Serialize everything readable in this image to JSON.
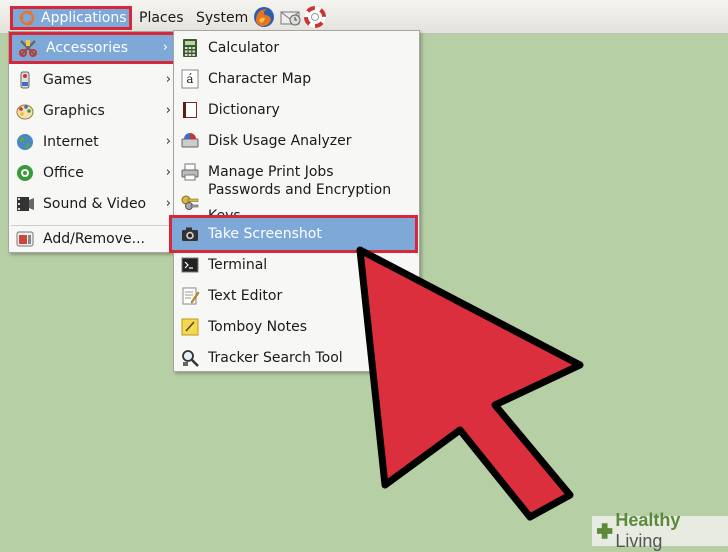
{
  "panel": {
    "applications_label": "Applications",
    "places_label": "Places",
    "system_label": "System",
    "launchers": [
      "firefox-icon",
      "mail-icon",
      "help-icon"
    ]
  },
  "applications_menu": {
    "items": [
      {
        "label": "Accessories",
        "icon": "accessories-icon",
        "has_submenu": true,
        "highlighted": true
      },
      {
        "label": "Games",
        "icon": "games-icon",
        "has_submenu": true
      },
      {
        "label": "Graphics",
        "icon": "graphics-icon",
        "has_submenu": true
      },
      {
        "label": "Internet",
        "icon": "internet-icon",
        "has_submenu": true
      },
      {
        "label": "Office",
        "icon": "office-icon",
        "has_submenu": true
      },
      {
        "label": "Sound & Video",
        "icon": "sound-video-icon",
        "has_submenu": true
      }
    ],
    "footer_item": {
      "label": "Add/Remove...",
      "icon": "add-remove-icon"
    }
  },
  "accessories_menu": {
    "items": [
      {
        "label": "Calculator",
        "icon": "calculator-icon"
      },
      {
        "label": "Character Map",
        "icon": "character-map-icon"
      },
      {
        "label": "Dictionary",
        "icon": "dictionary-icon"
      },
      {
        "label": "Disk Usage Analyzer",
        "icon": "disk-usage-icon"
      },
      {
        "label": "Manage Print Jobs",
        "icon": "printer-icon"
      },
      {
        "label": "Passwords and Encryption Keys",
        "icon": "keys-icon"
      },
      {
        "label": "Take Screenshot",
        "icon": "camera-icon",
        "highlighted": true
      },
      {
        "label": "Terminal",
        "icon": "terminal-icon"
      },
      {
        "label": "Text Editor",
        "icon": "text-editor-icon"
      },
      {
        "label": "Tomboy Notes",
        "icon": "notes-icon"
      },
      {
        "label": "Tracker Search Tool",
        "icon": "search-tool-icon"
      }
    ],
    "char_map_glyph": "á"
  },
  "submenu_arrow": "›",
  "watermark": {
    "brand_bold": "Healthy",
    "brand_rest": " Living"
  },
  "colors": {
    "highlight": "#7da8d8",
    "callout_red": "#d6283a",
    "desktop": "#b7cfa5"
  }
}
